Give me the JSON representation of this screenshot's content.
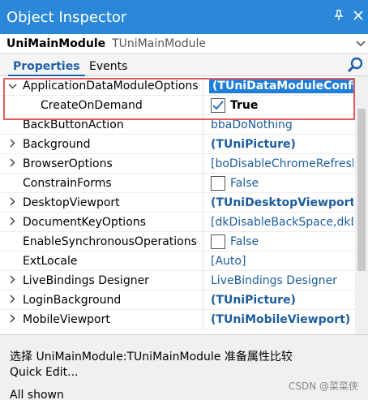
{
  "window": {
    "title": "Object Inspector",
    "pin_icon": "pin-icon",
    "close_icon": "close-icon"
  },
  "object_selector": {
    "name": "UniMainModule",
    "type": "TUniMainModule"
  },
  "tabs": [
    {
      "label": "Properties",
      "active": true
    },
    {
      "label": "Events",
      "active": false
    }
  ],
  "properties": [
    {
      "name": "ApplicationDataModuleOptions",
      "value": "(TUniDataModuleConfig)",
      "expander": "expanded",
      "selected": true
    },
    {
      "name": "CreateOnDemand",
      "value": "True",
      "checkbox": true,
      "checked": true,
      "sub": true
    },
    {
      "name": "BackButtonAction",
      "value": "bbaDoNothing"
    },
    {
      "name": "Background",
      "value": "(TUniPicture)",
      "expander": "collapsed",
      "bold": true
    },
    {
      "name": "BrowserOptions",
      "value": "[boDisableChromeRefresh",
      "expander": "collapsed"
    },
    {
      "name": "ConstrainForms",
      "value": "False",
      "checkbox": true,
      "checked": false
    },
    {
      "name": "DesktopViewport",
      "value": "(TUniDesktopViewport)",
      "expander": "collapsed",
      "bold": true
    },
    {
      "name": "DocumentKeyOptions",
      "value": "[dkDisableBackSpace,dkDi",
      "expander": "collapsed"
    },
    {
      "name": "EnableSynchronousOperations",
      "value": "False",
      "checkbox": true,
      "checked": false
    },
    {
      "name": "ExtLocale",
      "value": "[Auto]"
    },
    {
      "name": "LiveBindings Designer",
      "value": "LiveBindings Designer",
      "expander": "collapsed"
    },
    {
      "name": "LoginBackground",
      "value": "(TUniPicture)",
      "expander": "collapsed",
      "bold": true
    },
    {
      "name": "MobileViewport",
      "value": "(TUniMobileViewport)",
      "expander": "collapsed",
      "bold": true
    }
  ],
  "status": {
    "line1": "选择 UniMainModule:TUniMainModule 准备属性比较",
    "line2": "Quick Edit...",
    "line3": "All shown",
    "watermark": "CSDN @菜菜侠"
  },
  "colors": {
    "title_bar": "#2b88d8",
    "value_text": "#1c5d9e",
    "selection": "#1e7ed8",
    "highlight_box": "#e05c5c"
  }
}
